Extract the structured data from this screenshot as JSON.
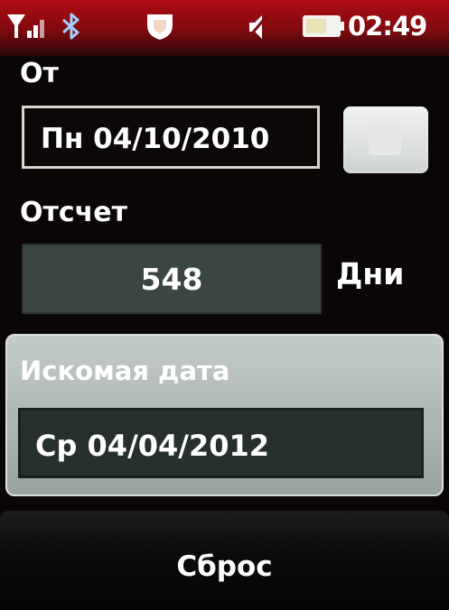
{
  "status_bar": {
    "time": "02:49",
    "icons": [
      "signal-icon",
      "bluetooth-icon",
      "shield-icon",
      "mute-icon",
      "battery-icon"
    ]
  },
  "form": {
    "from_label": "От",
    "from_value": "Пн 04/10/2010",
    "count_label": "Отсчет",
    "count_value": "548",
    "days_label": "Дни"
  },
  "result": {
    "label": "Искомая дата",
    "value": "Ср 04/04/2012"
  },
  "actions": {
    "reset_label": "Сброс"
  },
  "colors": {
    "status_bar": "#b10c14",
    "background": "#0a0605",
    "count_field": "#3a4642",
    "result_panel": "#c4ccc9",
    "result_field": "#26302e"
  }
}
